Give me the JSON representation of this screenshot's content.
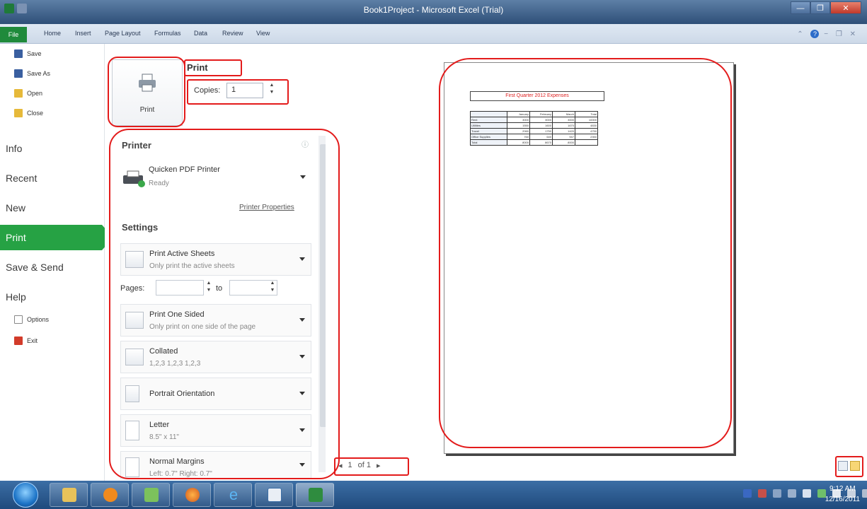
{
  "window": {
    "title": "Book1Project - Microsoft Excel (Trial)"
  },
  "ribbon": {
    "tabs": [
      "File",
      "Home",
      "Insert",
      "Page Layout",
      "Formulas",
      "Data",
      "Review",
      "View"
    ]
  },
  "backstage_nav": {
    "save": "Save",
    "save_as": "Save As",
    "open": "Open",
    "close": "Close",
    "info": "Info",
    "recent": "Recent",
    "new": "New",
    "print": "Print",
    "save_send": "Save & Send",
    "help": "Help",
    "options": "Options",
    "exit": "Exit"
  },
  "print_panel": {
    "print_button_label": "Print",
    "heading": "Print",
    "copies_label": "Copies:",
    "copies_value": "1",
    "printer_heading": "Printer",
    "printer_name": "Quicken PDF Printer",
    "printer_status": "Ready",
    "printer_properties": "Printer Properties",
    "settings_heading": "Settings",
    "what_title": "Print Active Sheets",
    "what_sub": "Only print the active sheets",
    "pages_label": "Pages:",
    "pages_to": "to",
    "sides_title": "Print One Sided",
    "sides_sub": "Only print on one side of the page",
    "collate_title": "Collated",
    "collate_sub": "1,2,3   1,2,3   1,2,3",
    "orientation_title": "Portrait Orientation",
    "paper_title": "Letter",
    "paper_sub": "8.5\" x 11\"",
    "margins_title": "Normal Margins",
    "margins_sub": "Left: 0.7\"   Right: 0.7\""
  },
  "preview": {
    "sheet_title": "First Quarter 2012 Expenses",
    "table_header": [
      "",
      "January",
      "February",
      "March",
      "Total"
    ],
    "table_rows": [
      [
        "Rent",
        "3000",
        "3000",
        "3000",
        "10000"
      ],
      [
        "Utilities",
        "1550",
        "1600",
        "1670",
        "4830"
      ],
      [
        "Travel",
        "2060",
        "1750",
        "1420",
        "4750"
      ],
      [
        "Office Supplies",
        "760",
        "640",
        "947",
        "2350"
      ],
      [
        "Total",
        "8000",
        "8670",
        "8000",
        ""
      ]
    ],
    "page_number": "1",
    "page_of": "of 1"
  },
  "taskbar": {
    "time": "9:12 AM",
    "date": "12/16/2011"
  },
  "colors": {
    "file_tab": "#1f8a3b",
    "print_active": "#26a244",
    "annotation": "#e31b1b"
  }
}
